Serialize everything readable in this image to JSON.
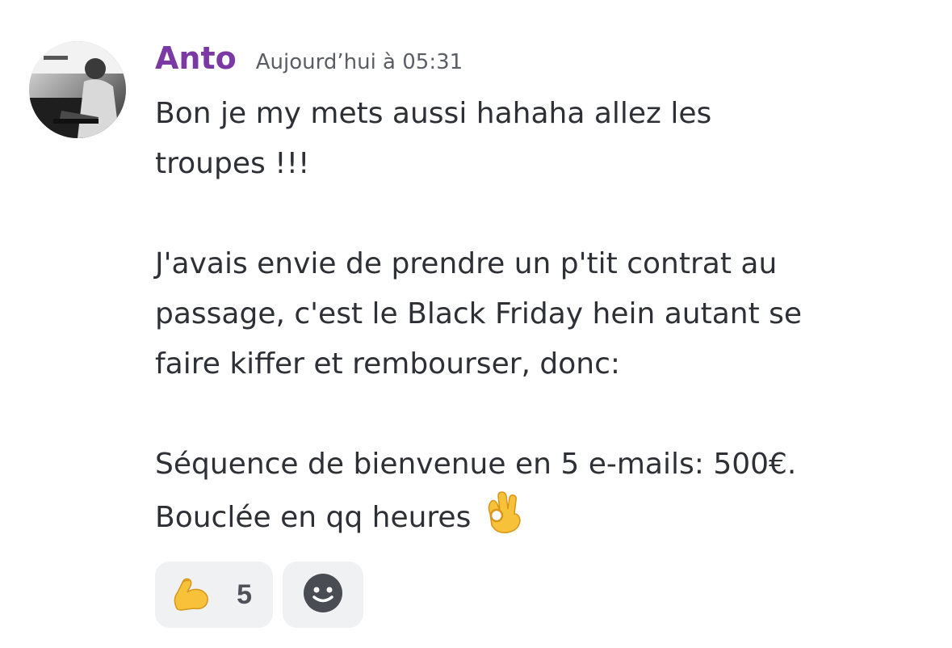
{
  "message": {
    "author": "Anto",
    "timestamp": "Aujourd’hui à 05:31",
    "lines": [
      "Bon je my mets aussi hahaha allez les",
      "troupes !!!",
      "",
      "J'avais envie de prendre un p'tit contrat au",
      "passage, c'est le Black Friday hein autant se",
      "faire kiffer et rembourser, donc:",
      "",
      "Séquence de bienvenue en 5 e-mails: 500€.",
      "Bouclée en qq heures"
    ],
    "trailing_emoji": "ok-hand-icon",
    "author_color": "#7b3aa3"
  },
  "reactions": [
    {
      "emoji": "flexed-biceps-icon",
      "count": "5"
    },
    {
      "emoji": "add-reaction-icon"
    }
  ]
}
